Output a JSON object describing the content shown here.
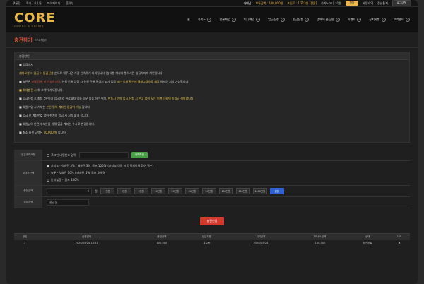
{
  "topbar": {
    "links": [
      "쿠폰함",
      "쪽지 [ 0 ] 통",
      "마이페이지",
      "출석부"
    ],
    "user": "카페님",
    "balance_label": "보유금액 : 100,000원",
    "point_label": "포인트 : 1,213원 [전환]",
    "level_label": "카지노머니 : 0원",
    "convert_btn": "전환",
    "deposit_btn": "배팅내역",
    "settle_btn": "정산통계",
    "logout_btn": "로그아웃"
  },
  "logo": {
    "main": "CORE",
    "sub": "CASINO & SPORTS"
  },
  "menu": [
    "홈",
    "카지노",
    "슬롯게임",
    "미니게임",
    "입금신청",
    "출금신청",
    "명예의 홀딩팡",
    "이벤트",
    "공지사항",
    "고객센터"
  ],
  "page_title": {
    "ko": "충전하기",
    "en": "charge"
  },
  "notes_panel": {
    "head": "충전방법",
    "title": "■ 입금순서",
    "lines": [
      {
        "y": "계좌요청 > 입금 > 입금신청",
        "t": " 순으로 해주시면 가장 신속하게 처리됩니다 (승식행 자치지 행으시면 입금처리에 지연됩니다)"
      },
      {
        "t": "■ 충전은 ",
        "r": "한명 단위 만 가능하시며,",
        "t2": " 천원 단위 입금 시 천원 단위 절하시 조가 입금 ",
        "y": "또는 이체 확인에 텔레그램으로 제휴",
        "t3": " 하셔야 처리 가능합니다."
      },
      {
        "y": "■ 최대충전 시 ",
        "t": "최 고액이 제외됩니다."
      },
      {
        "t": "■ 입금신청 후 최대 5분이내 입금처리 완료되지 않을 경우 지능 하는 위치, ",
        "y": "반드시 만약 입금 신청 시 콘고 없이 모든 이벤트 혜택 미지급 적발합니다."
      },
      {
        "t": "■ 회원가입 시 기재한 ",
        "y": "본인 명의 계좌만 입금이 가능",
        "t2": " 합니다."
      },
      {
        "t": "■ 입금 전 계좌번호 없이 한계의 입금 시 처리 불가 합니다."
      },
      {
        "t": "■ 회원님의 안전과 보안을 위해 입금 계좌는 수시로 변경됩니다."
      },
      {
        "t": "■ 최소 충전 금액은 ",
        "y": "10,000 원",
        "t2": " 입니다."
      }
    ]
  },
  "form": {
    "account_label": "입금계좌요청",
    "account_check": "로그인 비밀번호 입력",
    "account_btn": "계좌확인",
    "bonus_label": "보너스선택",
    "bonus_options": [
      {
        "t": "카지노 - 첫충전 3% / 매충전 3% ",
        "g": "콤프 100%",
        "t2": " (카지노 이용 시 당일체이쳐 참여 필수)"
      },
      {
        "t": "슬롯 - 첫충전 10% / 매충전 5% ",
        "g": "콤프 100%",
        "t2": ""
      },
      {
        "t": "받지않음 - ",
        "g": "콤프 100%",
        "t2": ""
      }
    ],
    "amount_label": "충전금액",
    "amount_value": "0",
    "amount_unit": "원",
    "amount_buttons": [
      "1만원",
      "3만원",
      "5만원",
      "10만원",
      "20만원",
      "30만원",
      "50만원",
      "100만원",
      "500만원",
      "1000만원",
      "정정"
    ],
    "name_label": "입금자명",
    "name_value": "홍길동",
    "submit": "충전신청"
  },
  "table": {
    "headers": [
      "번호",
      "신청날짜",
      "충전금액",
      "입금자명",
      "처리날짜",
      "보너스금액",
      "상태",
      "삭제"
    ],
    "rows": [
      [
        "7",
        "2026/05/24 14:41",
        "100,000",
        "홍길동",
        "2026/05/24",
        "100,000",
        "승인완료",
        "✖"
      ]
    ]
  }
}
